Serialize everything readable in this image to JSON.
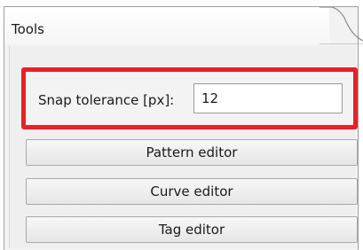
{
  "panel": {
    "tab_title": "Tools"
  },
  "snap": {
    "label": "Snap tolerance [px]:",
    "value": "12"
  },
  "buttons": {
    "pattern_editor": "Pattern editor",
    "curve_editor": "Curve editor",
    "tag_editor": "Tag editor"
  },
  "colors": {
    "highlight": "#e8202a"
  }
}
